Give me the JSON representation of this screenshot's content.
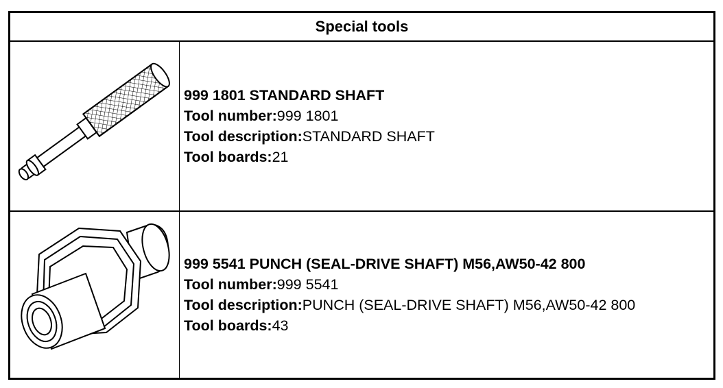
{
  "header": {
    "title": "Special tools"
  },
  "tools": [
    {
      "title": "999 1801 STANDARD SHAFT",
      "number_label": "Tool number:",
      "number": "999 1801",
      "description_label": "Tool description:",
      "description": "STANDARD SHAFT",
      "boards_label": "Tool boards:",
      "boards": "21",
      "illustration": "standard-shaft-illustration"
    },
    {
      "title": "999 5541 PUNCH (SEAL-DRIVE SHAFT) M56,AW50-42 800",
      "number_label": "Tool number:",
      "number": "999 5541",
      "description_label": "Tool description:",
      "description": "PUNCH (SEAL-DRIVE SHAFT) M56,AW50-42 800",
      "boards_label": "Tool boards:",
      "boards": "43",
      "illustration": "seal-drive-punch-illustration"
    }
  ]
}
